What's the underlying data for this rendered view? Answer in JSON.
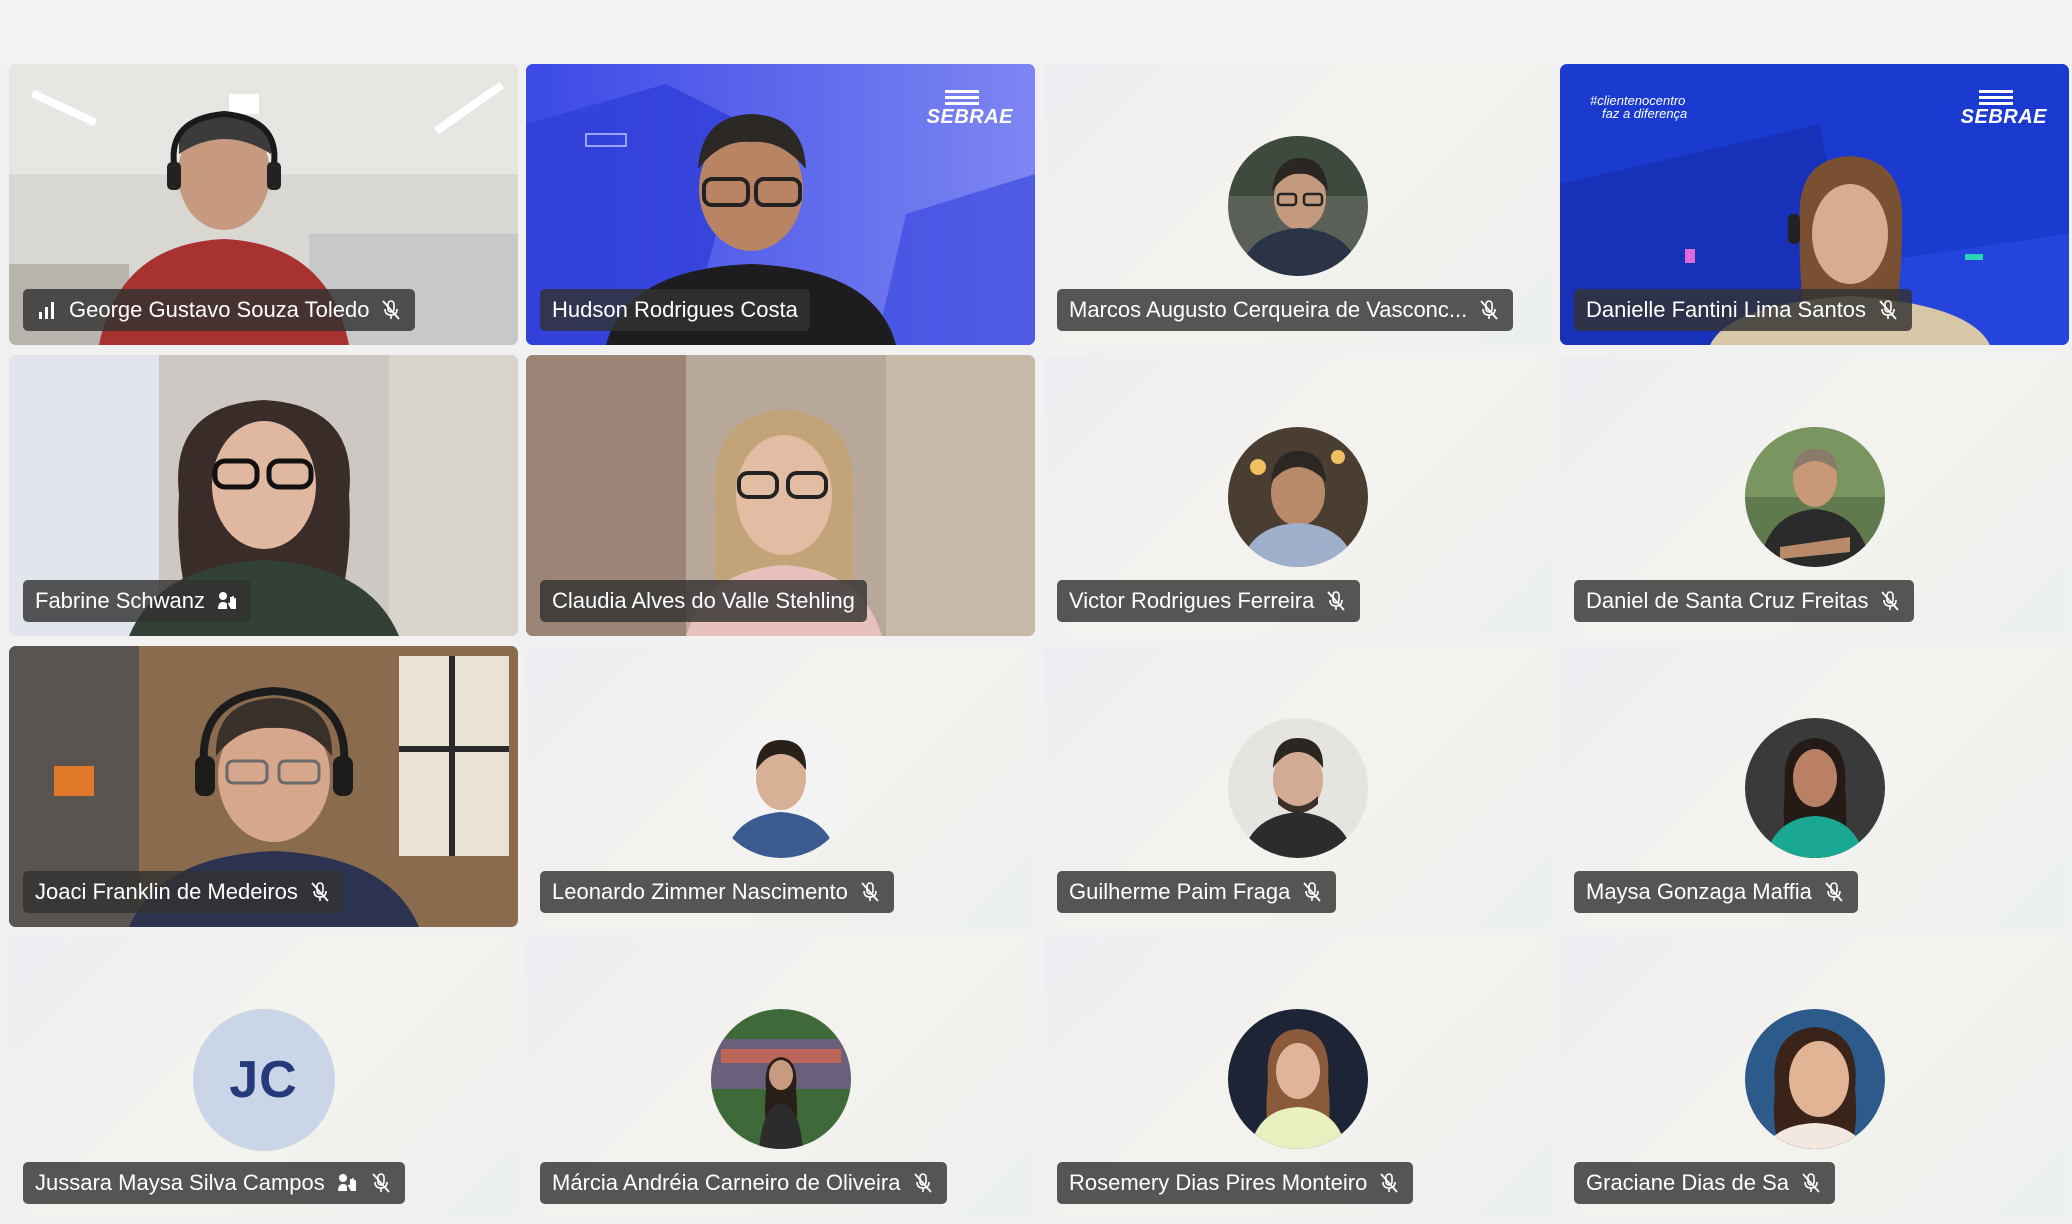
{
  "meeting": {
    "participants": [
      {
        "name": "George Gustavo Souza Toledo",
        "mic": "speaking",
        "video": true
      },
      {
        "name": "Hudson Rodrigues Costa",
        "mic": "none",
        "video": true,
        "brand": "SEBRAE"
      },
      {
        "name": "Marcos Augusto Cerqueira de Vasconc...",
        "mic": "muted",
        "video": false
      },
      {
        "name": "Danielle Fantini Lima Santos",
        "mic": "muted",
        "video": true,
        "brand": "SEBRAE",
        "hashtag": "#clientenocentro",
        "hashtag2": "faz a diferença"
      },
      {
        "name": "Fabrine Schwanz",
        "mic": "hand",
        "video": true
      },
      {
        "name": "Claudia Alves do Valle Stehling",
        "mic": "none",
        "video": true
      },
      {
        "name": "Victor Rodrigues Ferreira",
        "mic": "muted",
        "video": false
      },
      {
        "name": "Daniel de Santa Cruz Freitas",
        "mic": "muted",
        "video": false
      },
      {
        "name": "Joaci Franklin de Medeiros",
        "mic": "muted",
        "video": true
      },
      {
        "name": "Leonardo Zimmer Nascimento",
        "mic": "muted",
        "video": false
      },
      {
        "name": "Guilherme Paim Fraga",
        "mic": "muted",
        "video": false
      },
      {
        "name": "Maysa Gonzaga Maffia",
        "mic": "muted",
        "video": false
      },
      {
        "name": "Jussara Maysa Silva Campos",
        "mic": "muted",
        "video": false,
        "initials": "JC",
        "hand": true
      },
      {
        "name": "Márcia Andréia Carneiro de Oliveira",
        "mic": "muted",
        "video": false
      },
      {
        "name": "Rosemery Dias Pires Monteiro",
        "mic": "muted",
        "video": false
      },
      {
        "name": "Graciane Dias de Sa",
        "mic": "muted",
        "video": false
      }
    ]
  },
  "colors": {
    "active_border": "#6a70d6",
    "label_bg": "#323232",
    "brand_blue": "#1f3fd6"
  }
}
